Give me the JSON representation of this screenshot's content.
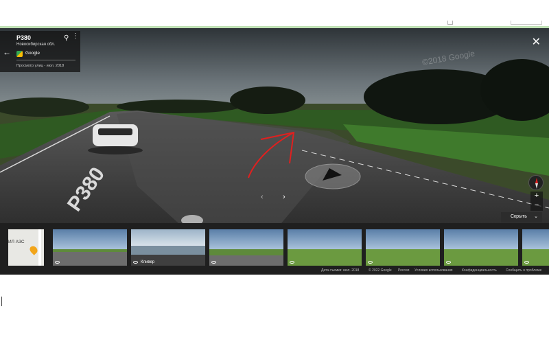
{
  "info_card": {
    "road_title": "Р380",
    "region": "Новосибирская обл.",
    "provider": "Google",
    "capture_info": "Просмотр улиц - июл. 2018",
    "back_icon": "arrow-left-icon",
    "pin_icon": "map-pin-icon",
    "more_icon": "more-vertical-icon"
  },
  "scene": {
    "road_marking": "Р380",
    "watermark": "©2018 Google",
    "annotation_color": "#e0201f"
  },
  "controls": {
    "close": "✕",
    "zoom_in": "+",
    "zoom_out": "−",
    "nav_left": "‹",
    "nav_right": "›",
    "hide_label": "Скрыть",
    "hide_chevron": "⌄"
  },
  "filmstrip": {
    "map_thumb_text": "ИЛ АЗС",
    "thumbnails": [
      {
        "label": ""
      },
      {
        "label": "Кливер"
      },
      {
        "label": ""
      },
      {
        "label": ""
      },
      {
        "label": ""
      },
      {
        "label": ""
      },
      {
        "label": ""
      }
    ]
  },
  "footer": {
    "capture_date": "Дата съемки: июл. 2018",
    "copyright": "© 2022 Google",
    "country": "Россия",
    "terms": "Условия использования",
    "privacy": "Конфиденциальность",
    "report": "Сообщить о проблеме"
  },
  "colors": {
    "panel_bg": "#1f1f1f",
    "accent_line": "#bfe0b4"
  }
}
